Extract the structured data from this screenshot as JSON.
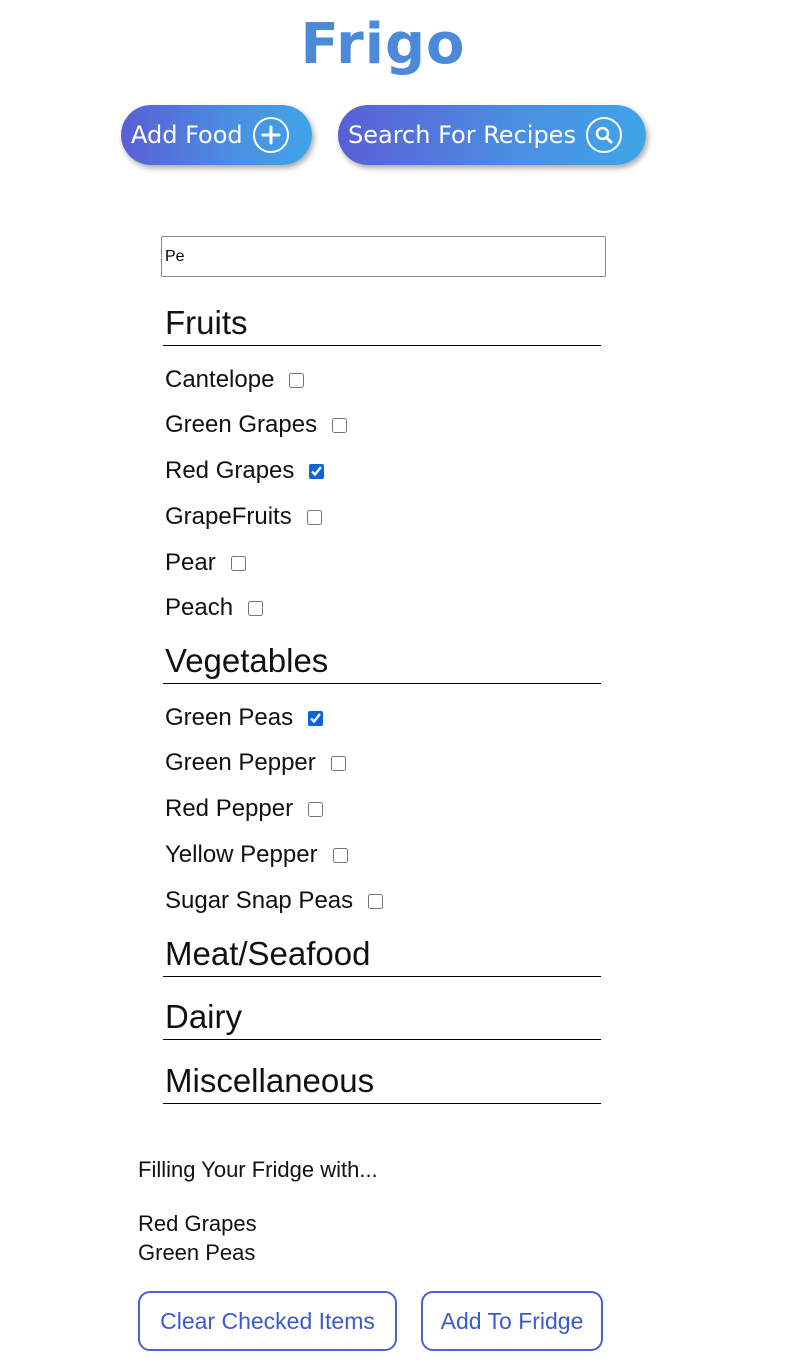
{
  "app": {
    "title": "Frigo"
  },
  "toolbar": {
    "add_food_label": "Add Food",
    "search_recipes_label": "Search For Recipes"
  },
  "search": {
    "value": "Pe"
  },
  "categories": {
    "fruits": {
      "heading": "Fruits",
      "items": [
        {
          "label": "Cantelope",
          "checked": false
        },
        {
          "label": "Green Grapes",
          "checked": false
        },
        {
          "label": "Red Grapes",
          "checked": true
        },
        {
          "label": "GrapeFruits",
          "checked": false
        },
        {
          "label": "Pear",
          "checked": false
        },
        {
          "label": "Peach",
          "checked": false
        }
      ]
    },
    "vegetables": {
      "heading": "Vegetables",
      "items": [
        {
          "label": "Green Peas",
          "checked": true
        },
        {
          "label": "Green Pepper",
          "checked": false
        },
        {
          "label": "Red Pepper",
          "checked": false
        },
        {
          "label": "Yellow Pepper",
          "checked": false
        },
        {
          "label": "Sugar Snap Peas",
          "checked": false
        }
      ]
    },
    "meat": {
      "heading": "Meat/Seafood"
    },
    "dairy": {
      "heading": "Dairy"
    },
    "misc": {
      "heading": "Miscellaneous"
    }
  },
  "summary": {
    "heading": "Filling Your Fridge with...",
    "items": [
      "Red Grapes",
      "Green Peas"
    ]
  },
  "actions": {
    "clear_label": "Clear Checked Items",
    "add_label": "Add To Fridge"
  },
  "colors": {
    "title": "#4a8ad8",
    "pill_start": "#5a5fd4",
    "pill_end": "#3fa4e8",
    "outline_button": "#4a60d8"
  },
  "icons": {
    "add": "plus-circle-icon",
    "search": "search-circle-icon"
  }
}
